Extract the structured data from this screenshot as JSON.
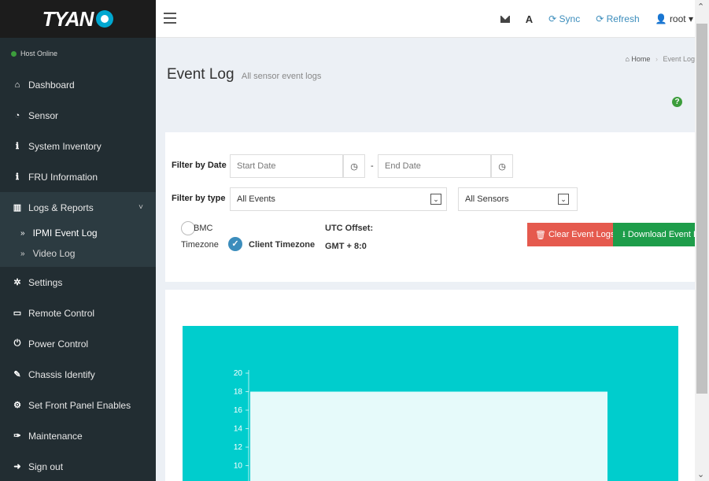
{
  "brand": {
    "logo_text": "TYAN"
  },
  "sidebar": {
    "host_status": "Host Online",
    "items": [
      {
        "label": "Dashboard",
        "icon": "home-icon"
      },
      {
        "label": "Sensor",
        "icon": "gauge-icon"
      },
      {
        "label": "System Inventory",
        "icon": "info-icon"
      },
      {
        "label": "FRU Information",
        "icon": "info-icon"
      },
      {
        "label": "Logs & Reports",
        "icon": "bar-chart-icon"
      },
      {
        "label": "Settings",
        "icon": "gear-icon"
      },
      {
        "label": "Remote Control",
        "icon": "monitor-icon"
      },
      {
        "label": "Power Control",
        "icon": "power-icon"
      },
      {
        "label": "Chassis Identify",
        "icon": "wrench-icon"
      },
      {
        "label": "Set Front Panel Enables",
        "icon": "cogs-icon"
      },
      {
        "label": "Maintenance",
        "icon": "wrench-icon"
      },
      {
        "label": "Sign out",
        "icon": "sign-out-icon"
      }
    ],
    "submenu": [
      {
        "label": "IPMI Event Log"
      },
      {
        "label": "Video Log"
      }
    ]
  },
  "header": {
    "sync_label": "Sync",
    "refresh_label": "Refresh",
    "user_label": "root"
  },
  "page": {
    "title": "Event Log",
    "subtitle": "All sensor event logs",
    "breadcrumb_home": "Home",
    "breadcrumb_current": "Event Log"
  },
  "filters": {
    "date_label": "Filter by Date",
    "start_placeholder": "Start Date",
    "end_placeholder": "End Date",
    "type_label": "Filter by type",
    "event_type_selected": "All Events",
    "sensor_selected": "All Sensors",
    "bmc_tz_label_1": "BMC",
    "bmc_tz_label_2": "Timezone",
    "client_tz_label": "Client Timezone",
    "utc_label": "UTC Offset:",
    "utc_value": "GMT + 8:0",
    "clear_button": "Clear Event Logs",
    "download_button": "Download Event Logs"
  },
  "colors": {
    "sidebar_bg": "#222d32",
    "chart_bg": "#00cdcd",
    "bar_fill": "#e6fafa",
    "clear_btn": "#e55a4e",
    "download_btn": "#1e9d4a"
  },
  "chart_data": {
    "type": "bar",
    "categories": [
      ""
    ],
    "values": [
      18
    ],
    "y_ticks": [
      10,
      12,
      14,
      16,
      18,
      20
    ],
    "ylim": [
      10,
      20
    ],
    "grid": false
  }
}
